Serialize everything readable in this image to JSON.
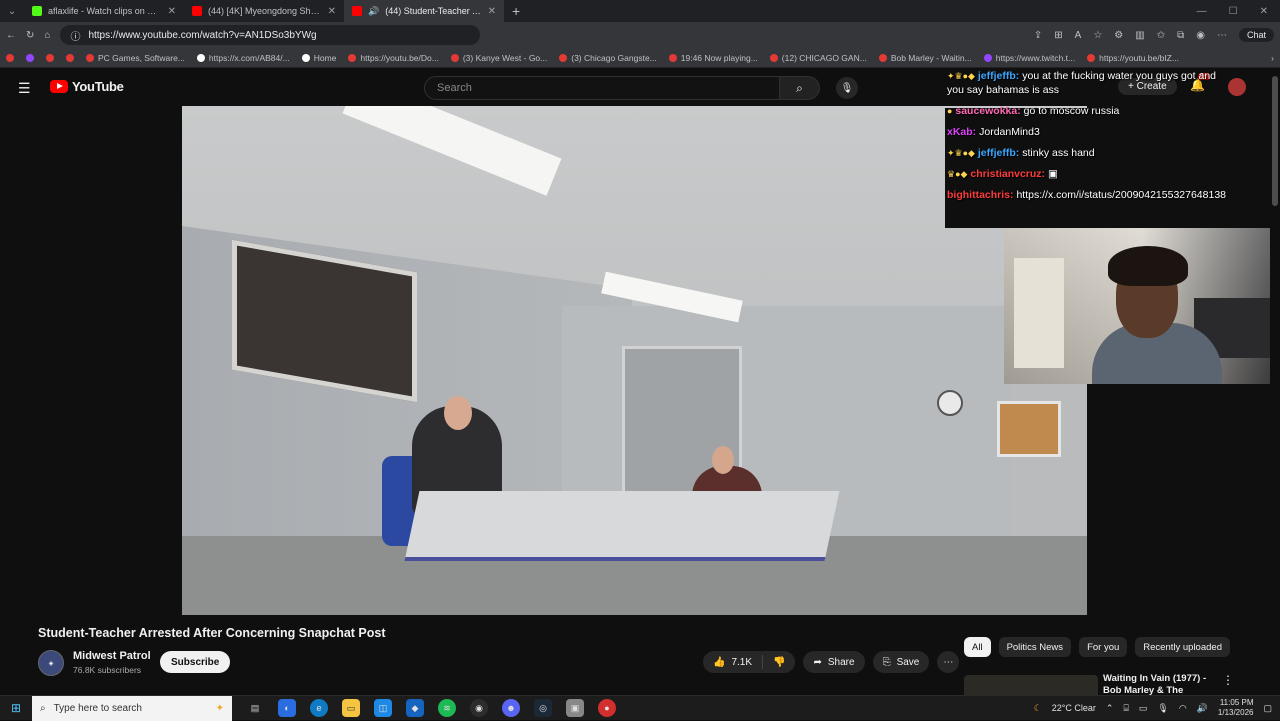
{
  "browser": {
    "tabs": [
      {
        "title": "aflaxlife - Watch clips on Kick",
        "color": "#53fc18",
        "active": false
      },
      {
        "title": "(44) [4K] Myeongdong Shopping",
        "color": "#ff0000",
        "active": false
      },
      {
        "title": "(44) Student-Teacher Arrested",
        "color": "#ff0000",
        "active": true
      }
    ],
    "url": "https://www.youtube.com/watch?v=AN1DSo3bYWg",
    "chat_button": "Chat",
    "bookmarks": [
      {
        "label": "",
        "color": "#e53935"
      },
      {
        "label": "",
        "color": "#9146ff"
      },
      {
        "label": "",
        "color": "#e53935"
      },
      {
        "label": "",
        "color": "#e53935"
      },
      {
        "label": "PC Games, Software...",
        "color": "#e53935"
      },
      {
        "label": "https://x.com/AB84/...",
        "color": "#ffffff"
      },
      {
        "label": "Home",
        "color": "#ffffff"
      },
      {
        "label": "https://youtu.be/Do...",
        "color": "#e53935"
      },
      {
        "label": "(3) Kanye West - Go...",
        "color": "#e53935"
      },
      {
        "label": "(3) Chicago Gangste...",
        "color": "#e53935"
      },
      {
        "label": "19:46 Now playing...",
        "color": "#e53935"
      },
      {
        "label": "(12) CHICAGO GAN...",
        "color": "#e53935"
      },
      {
        "label": "Bob Marley - Waitin...",
        "color": "#e53935"
      },
      {
        "label": "https://www.twitch.t...",
        "color": "#9146ff"
      },
      {
        "label": "https://youtu.be/bIZ...",
        "color": "#e53935"
      }
    ]
  },
  "youtube": {
    "logo_text": "YouTube",
    "search_placeholder": "Search",
    "create_label": "Create",
    "notif_count": "9+"
  },
  "chat": {
    "messages": [
      {
        "user": "jeffjeffb:",
        "text": "you at the fucking water you guys got and",
        "color": "c-blue"
      },
      {
        "user": "",
        "text": "you say bahamas is ass",
        "color": "c-blue"
      },
      {
        "user": "saucewokka:",
        "text": "go to moscow russia",
        "color": "c-pink"
      },
      {
        "user": "xKab:",
        "text": "JordanMind3",
        "color": "c-magenta"
      },
      {
        "user": "jeffjeffb:",
        "text": "stinky ass hand",
        "color": "c-blue"
      },
      {
        "user": "christianvcruz:",
        "text": "",
        "color": "c-red"
      },
      {
        "user": "bighittachris:",
        "text": "https://x.com/i/status/2009042155327648138",
        "color": "c-red"
      }
    ]
  },
  "video": {
    "title": "Student-Teacher Arrested After Concerning Snapchat Post",
    "channel": "Midwest Patrol",
    "subscribers": "76.8K subscribers",
    "subscribe_label": "Subscribe",
    "likes": "7.1K",
    "share_label": "Share",
    "save_label": "Save"
  },
  "chips": [
    "All",
    "Politics News",
    "For you",
    "Recently uploaded"
  ],
  "recommendation": {
    "title": "Waiting In Vain (1977) - Bob Marley & The Wailers"
  },
  "taskbar": {
    "search_placeholder": "Type here to search",
    "weather": "22°C  Clear",
    "time": "11:05 PM",
    "date": "1/13/2026"
  }
}
